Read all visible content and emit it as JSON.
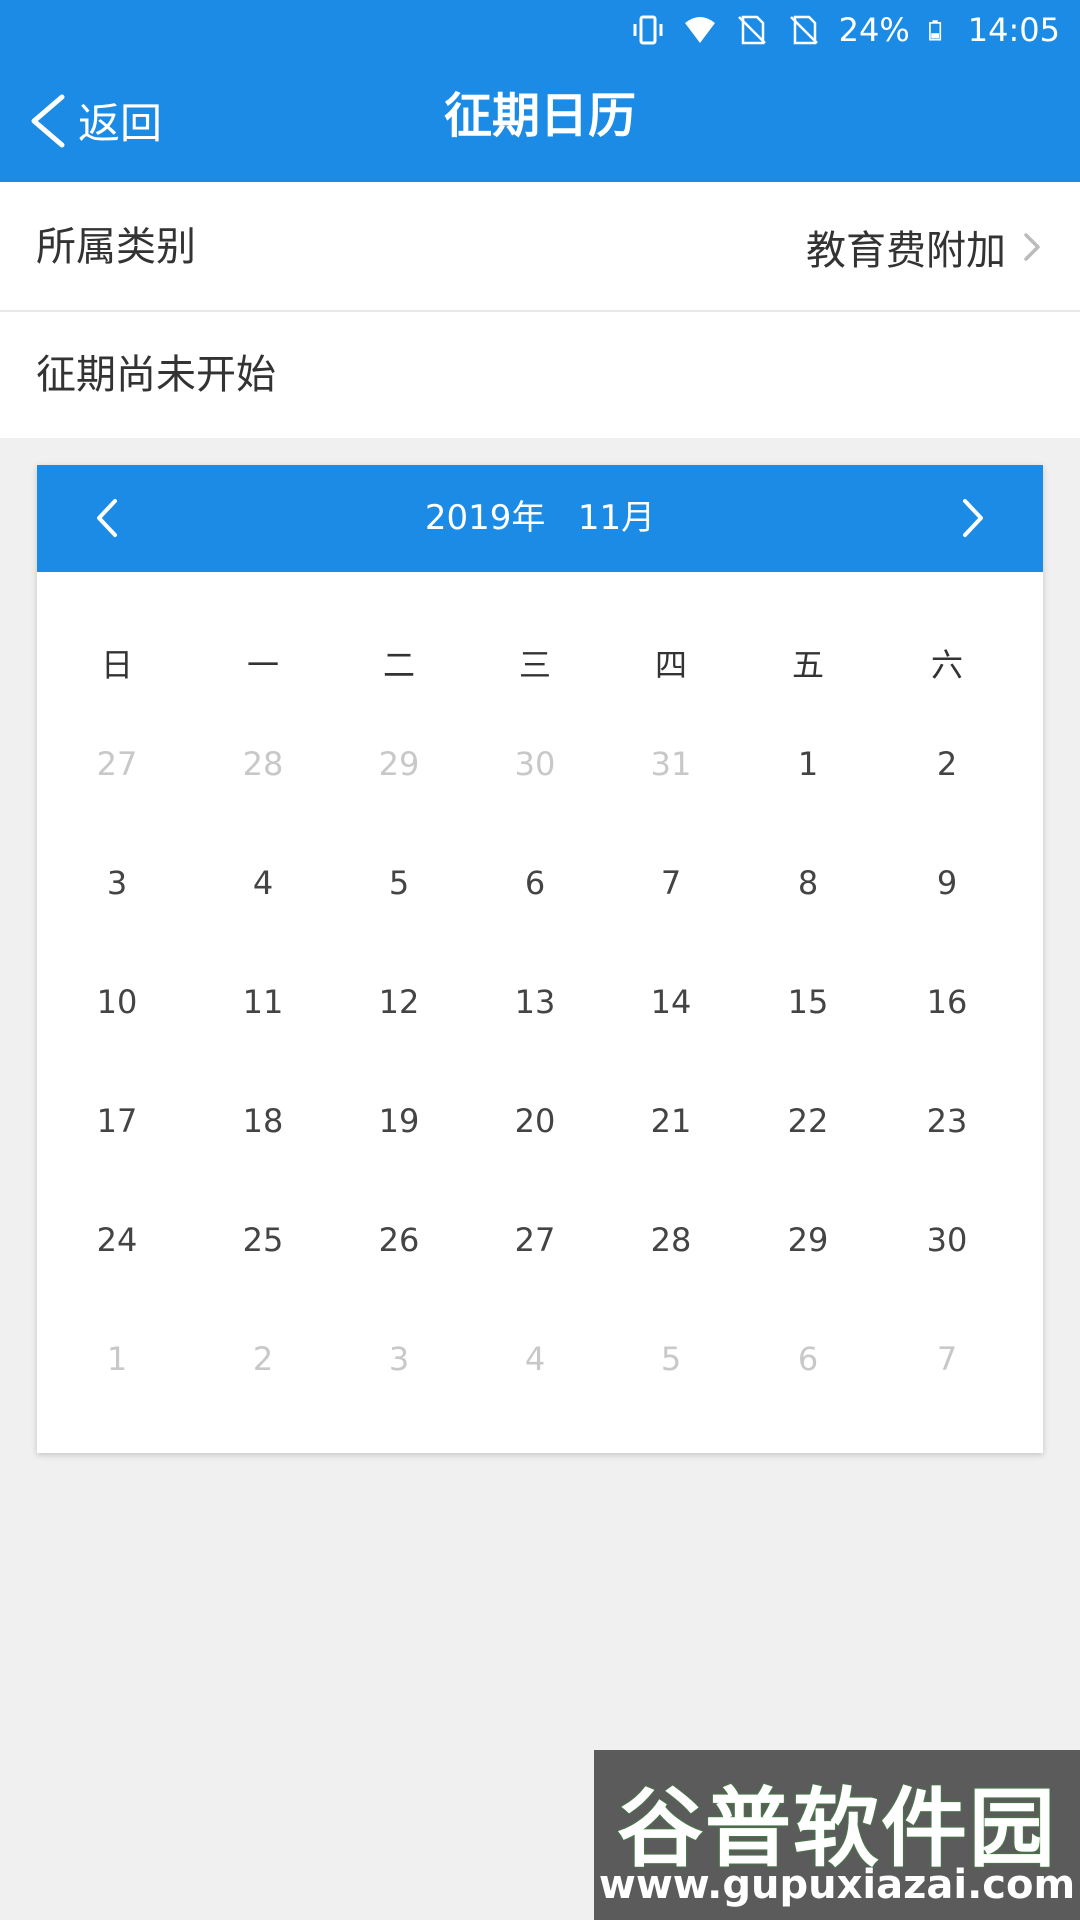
{
  "status_bar": {
    "battery": "24%",
    "time": "14:05",
    "icons": [
      "vibrate-icon",
      "wifi-icon",
      "no-sim-icon",
      "no-sim-icon",
      "battery-icon"
    ]
  },
  "nav": {
    "back_label": "返回",
    "title": "征期日历"
  },
  "category_row": {
    "label": "所属类别",
    "value": "教育费附加"
  },
  "status_row": {
    "text": "征期尚未开始"
  },
  "calendar": {
    "title": "2019年   11月",
    "weekdays": [
      "日",
      "一",
      "二",
      "三",
      "四",
      "五",
      "六"
    ],
    "weeks": [
      [
        {
          "d": "27",
          "m": true
        },
        {
          "d": "28",
          "m": true
        },
        {
          "d": "29",
          "m": true
        },
        {
          "d": "30",
          "m": true
        },
        {
          "d": "31",
          "m": true
        },
        {
          "d": "1",
          "m": false
        },
        {
          "d": "2",
          "m": false
        }
      ],
      [
        {
          "d": "3",
          "m": false
        },
        {
          "d": "4",
          "m": false
        },
        {
          "d": "5",
          "m": false
        },
        {
          "d": "6",
          "m": false
        },
        {
          "d": "7",
          "m": false
        },
        {
          "d": "8",
          "m": false
        },
        {
          "d": "9",
          "m": false
        }
      ],
      [
        {
          "d": "10",
          "m": false
        },
        {
          "d": "11",
          "m": false
        },
        {
          "d": "12",
          "m": false
        },
        {
          "d": "13",
          "m": false
        },
        {
          "d": "14",
          "m": false
        },
        {
          "d": "15",
          "m": false
        },
        {
          "d": "16",
          "m": false
        }
      ],
      [
        {
          "d": "17",
          "m": false
        },
        {
          "d": "18",
          "m": false
        },
        {
          "d": "19",
          "m": false
        },
        {
          "d": "20",
          "m": false
        },
        {
          "d": "21",
          "m": false
        },
        {
          "d": "22",
          "m": false
        },
        {
          "d": "23",
          "m": false
        }
      ],
      [
        {
          "d": "24",
          "m": false
        },
        {
          "d": "25",
          "m": false
        },
        {
          "d": "26",
          "m": false
        },
        {
          "d": "27",
          "m": false
        },
        {
          "d": "28",
          "m": false
        },
        {
          "d": "29",
          "m": false
        },
        {
          "d": "30",
          "m": false
        }
      ],
      [
        {
          "d": "1",
          "m": true
        },
        {
          "d": "2",
          "m": true
        },
        {
          "d": "3",
          "m": true
        },
        {
          "d": "4",
          "m": true
        },
        {
          "d": "5",
          "m": true
        },
        {
          "d": "6",
          "m": true
        },
        {
          "d": "7",
          "m": true
        }
      ]
    ]
  },
  "watermark": {
    "top": "谷普软件园",
    "bottom": "www.gupuxiazai.com"
  },
  "colors": {
    "primary": "#1b8be6",
    "muted_day": "#c8c8c8",
    "background": "#f0f0f0"
  }
}
